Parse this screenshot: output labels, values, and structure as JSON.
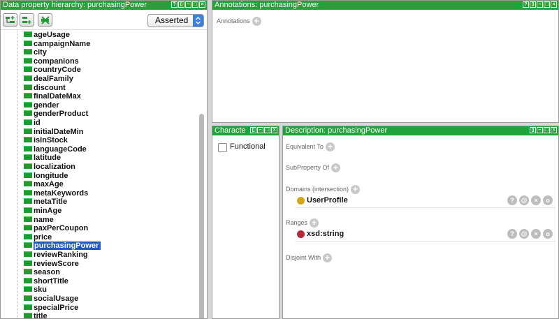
{
  "left_panel": {
    "title": "Data property hierarchy: purchasingPower",
    "title_buttons": [
      "?",
      "▯",
      "–",
      "□",
      "×"
    ],
    "toolbar": {
      "add_sub_icon": "add-subproperty-icon",
      "add_sibling_icon": "add-sibling-property-icon",
      "delete_icon": "delete-property-icon",
      "select_value": "Asserted"
    },
    "items": [
      "ageUsage",
      "campaignName",
      "city",
      "companions",
      "countryCode",
      "dealFamily",
      "discount",
      "finalDateMax",
      "gender",
      "genderProduct",
      "id",
      "initialDateMin",
      "isInStock",
      "languageCode",
      "latitude",
      "localization",
      "longitude",
      "maxAge",
      "metaKeywords",
      "metaTitle",
      "minAge",
      "name",
      "paxPerCoupon",
      "price",
      "purchasingPower",
      "reviewRanking",
      "reviewScore",
      "season",
      "shortTitle",
      "sku",
      "socialUsage",
      "specialPrice",
      "title"
    ],
    "selected": "purchasingPower"
  },
  "annotations_panel": {
    "title": "Annotations: purchasingPower",
    "label": "Annotations",
    "title_buttons": [
      "?",
      "▯",
      "–",
      "□",
      "×"
    ]
  },
  "characteristics_panel": {
    "title": "Characte",
    "title_buttons": [
      "▯",
      "–",
      "□",
      "×"
    ],
    "functional_label": "Functional"
  },
  "description_panel": {
    "title": "Description: purchasingPower",
    "title_buttons": [
      "▯",
      "–",
      "□",
      "×"
    ],
    "equivalent_to": "Equivalent To",
    "subproperty_of": "SubProperty Of",
    "domains": "Domains (intersection)",
    "domain_value": "UserProfile",
    "ranges": "Ranges",
    "range_value": "xsd:string",
    "disjoint_with": "Disjoint With",
    "action_glyphs": [
      "?",
      "@",
      "×",
      "o"
    ],
    "colors": {
      "domain_dot": "#d4a614",
      "range_dot": "#b8263a"
    }
  },
  "colors": {
    "titlebar": "#1fa33a",
    "selection": "#1f56c8",
    "property_bar": "#1f9b32"
  }
}
